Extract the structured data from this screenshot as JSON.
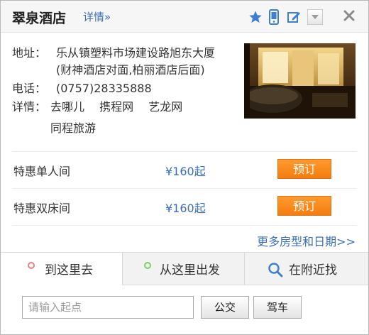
{
  "header": {
    "title": "翠泉酒店",
    "detail_link": "详情»",
    "icons": [
      "star-icon",
      "phone-icon",
      "edit-icon",
      "chevron-down-icon",
      "close-icon"
    ]
  },
  "info": {
    "address_label": "地址：",
    "address_line1": "乐从镇塑料市场建设路旭东大厦",
    "address_line2": "(财神酒店对面,柏丽酒店后面)",
    "phone_label": "电话：",
    "phone": "(0757)28335888",
    "detail_label": "详情：",
    "links": [
      "去哪儿",
      "携程网",
      "艺龙网",
      "同程旅游"
    ]
  },
  "rooms": [
    {
      "name": "特惠单人间",
      "price": "¥160起",
      "action": "预订"
    },
    {
      "name": "特惠双床间",
      "price": "¥160起",
      "action": "预订"
    }
  ],
  "more_link": "更多房型和日期>>",
  "tabs": {
    "go_here": "到这里去",
    "from_here": "从这里出发",
    "nearby": "在附近找"
  },
  "route": {
    "placeholder": "请输入起点",
    "bus_label": "公交",
    "drive_label": "驾车"
  },
  "colors": {
    "accent_blue": "#3b6fb6",
    "book_orange": "#f6861a",
    "go_dot": "#f08080",
    "from_dot": "#7ccf6a"
  }
}
